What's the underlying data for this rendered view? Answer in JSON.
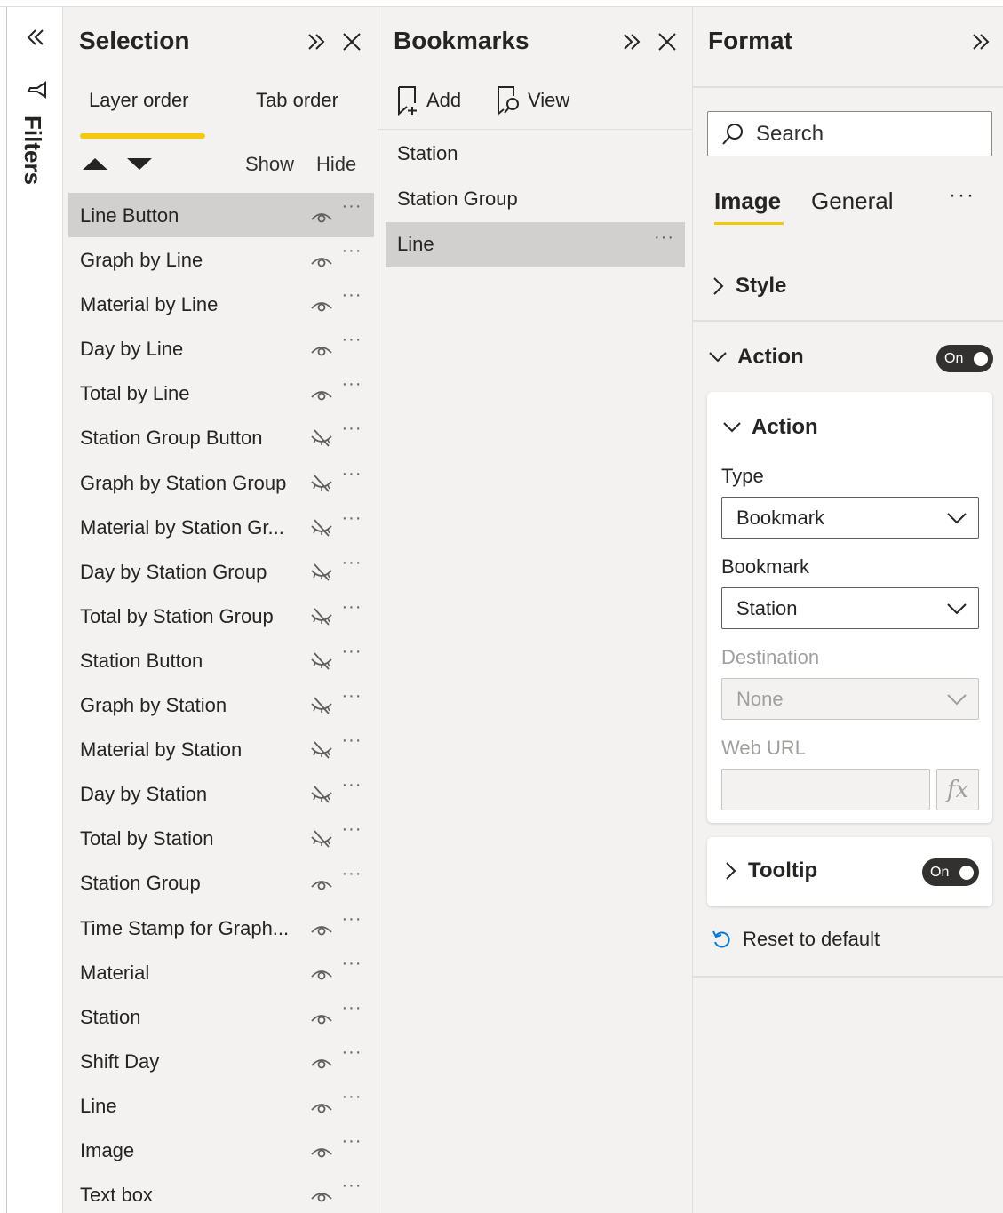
{
  "filters_rail": {
    "label": "Filters"
  },
  "selection": {
    "title": "Selection",
    "tabs": [
      {
        "label": "Layer order"
      },
      {
        "label": "Tab order"
      }
    ],
    "show_label": "Show",
    "hide_label": "Hide",
    "layers": [
      {
        "name": "Line Button",
        "visible": true,
        "selected": true
      },
      {
        "name": "Graph by Line",
        "visible": true
      },
      {
        "name": "Material by Line",
        "visible": true
      },
      {
        "name": "Day by Line",
        "visible": true
      },
      {
        "name": "Total by Line",
        "visible": true
      },
      {
        "name": "Station Group Button",
        "visible": false
      },
      {
        "name": "Graph by Station Group",
        "visible": false
      },
      {
        "name": "Material by Station Gr...",
        "visible": false
      },
      {
        "name": "Day by Station Group",
        "visible": false
      },
      {
        "name": "Total by Station Group",
        "visible": false
      },
      {
        "name": "Station Button",
        "visible": false
      },
      {
        "name": "Graph by Station",
        "visible": false
      },
      {
        "name": "Material by Station",
        "visible": false
      },
      {
        "name": "Day by Station",
        "visible": false
      },
      {
        "name": "Total by Station",
        "visible": false
      },
      {
        "name": "Station Group",
        "visible": true
      },
      {
        "name": "Time Stamp for Graph...",
        "visible": true
      },
      {
        "name": "Material",
        "visible": true
      },
      {
        "name": "Station",
        "visible": true
      },
      {
        "name": "Shift Day",
        "visible": true
      },
      {
        "name": "Line",
        "visible": true
      },
      {
        "name": "Image",
        "visible": true
      },
      {
        "name": "Text box",
        "visible": true
      }
    ]
  },
  "bookmarks": {
    "title": "Bookmarks",
    "add_label": "Add",
    "view_label": "View",
    "items": [
      {
        "name": "Station"
      },
      {
        "name": "Station Group"
      },
      {
        "name": "Line",
        "selected": true
      }
    ]
  },
  "format": {
    "title": "Format",
    "search_placeholder": "Search",
    "tabs": [
      {
        "label": "Image"
      },
      {
        "label": "General"
      }
    ],
    "style_label": "Style",
    "action_section_label": "Action",
    "action_toggle_label": "On",
    "action_card": {
      "title": "Action",
      "type_label": "Type",
      "type_value": "Bookmark",
      "bookmark_label": "Bookmark",
      "bookmark_value": "Station",
      "destination_label": "Destination",
      "destination_value": "None",
      "web_url_label": "Web URL",
      "fx_label": "fx"
    },
    "tooltip_label": "Tooltip",
    "tooltip_toggle_label": "On",
    "reset_label": "Reset to default"
  },
  "colors": {
    "accent": "#f2c811",
    "pane_bg": "#f3f2f1",
    "selected_row": "#d2d0ce",
    "toggle_bg": "#323130"
  }
}
